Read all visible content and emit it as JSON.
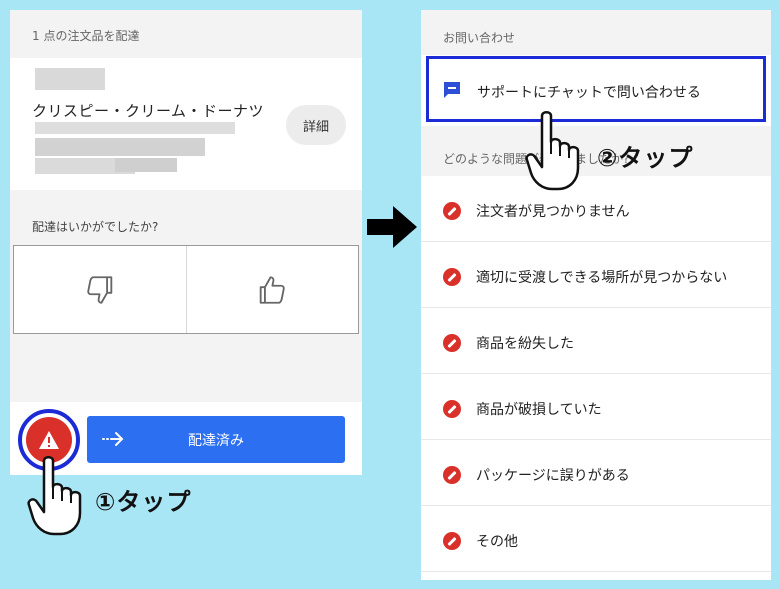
{
  "left": {
    "order_header": "1 点の注文品を配達",
    "shop_name": "クリスピー・クリーム・ドーナツ",
    "detail_button": "詳細",
    "rating_prompt": "配達はいかがでしたか?",
    "thumbs_down_icon": "thumbs-down-icon",
    "thumbs_up_icon": "thumbs-up-icon",
    "alert_icon": "warning-icon",
    "delivered_button": "配達済み"
  },
  "right": {
    "contact_header": "お問い合わせ",
    "chat_support": "サポートにチャットで問い合わせる",
    "problem_header": "どのような問題が発生しましたか?",
    "issues": [
      "注文者が見つかりません",
      "適切に受渡しできる場所が見つからない",
      "商品を紛失した",
      "商品が破損していた",
      "パッケージに誤りがある",
      "その他"
    ]
  },
  "annotations": {
    "step1": "①タップ",
    "step2": "②タップ"
  },
  "colors": {
    "background": "#a9e6f5",
    "highlight_border": "#1b2bd6",
    "danger": "#d9302a",
    "primary": "#2c6ff0"
  }
}
